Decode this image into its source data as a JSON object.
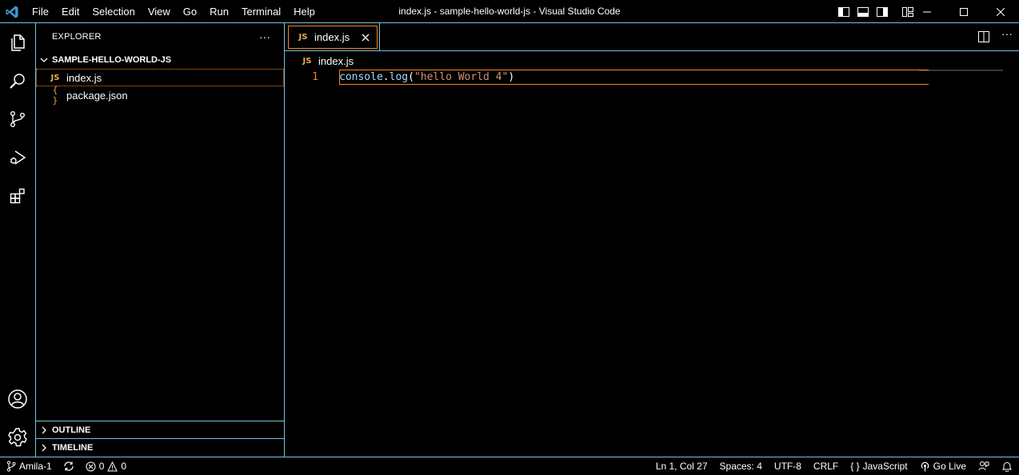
{
  "window": {
    "title": "index.js - sample-hello-world-js - Visual Studio Code"
  },
  "menu": [
    "File",
    "Edit",
    "Selection",
    "View",
    "Go",
    "Run",
    "Terminal",
    "Help"
  ],
  "sidebar": {
    "title": "EXPLORER",
    "more": "···",
    "folder": "SAMPLE-HELLO-WORLD-JS",
    "files": [
      {
        "icon": "JS",
        "name": "index.js"
      },
      {
        "icon": "{ }",
        "name": "package.json"
      }
    ],
    "outline": "OUTLINE",
    "timeline": "TIMELINE"
  },
  "editor": {
    "tab": {
      "icon": "JS",
      "label": "index.js"
    },
    "more": "···",
    "breadcrumb": {
      "icon": "JS",
      "label": "index.js"
    },
    "line_number": "1",
    "code": {
      "ident": "console",
      "dot": ".",
      "method": "log",
      "open": "(",
      "str": "\"hello World 4\"",
      "close": ")"
    }
  },
  "status": {
    "branch": "Amila-1",
    "errors": "0",
    "warnings": "0",
    "position": "Ln 1, Col 27",
    "spaces": "Spaces: 4",
    "encoding": "UTF-8",
    "eol": "CRLF",
    "language_icon": "{ }",
    "language": "JavaScript",
    "golive": "Go Live"
  },
  "colors": {
    "accent_border": "#6fc3df",
    "focus_orange": "#f38518",
    "js_icon": "#e8ab53",
    "vscode_blue": "#3c99d4"
  }
}
